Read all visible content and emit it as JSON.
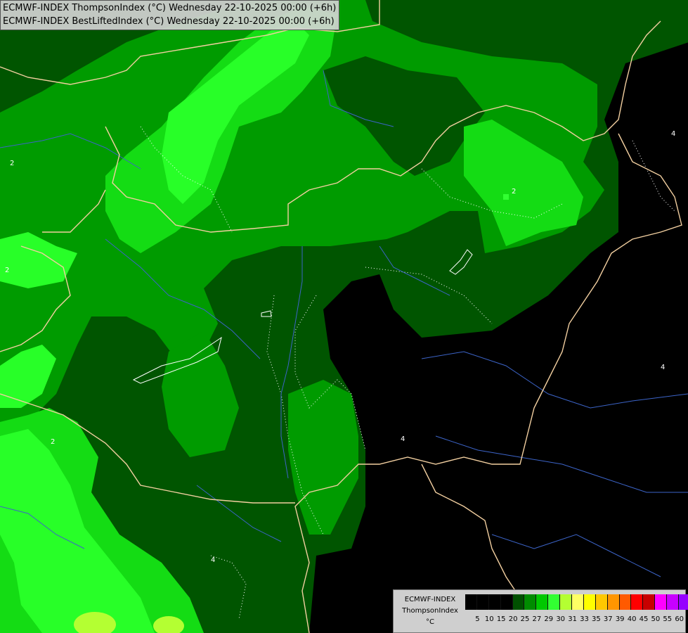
{
  "titles": {
    "line1": "ECMWF-INDEX ThompsonIndex (°C) Wednesday 22-10-2025 00:00 (+6h)",
    "line2": "ECMWF-INDEX BestLiftedIndex (°C) Wednesday 22-10-2025 00:00 (+6h)"
  },
  "legend": {
    "title": "ECMWF-INDEX",
    "subtitle": "ThompsonIndex",
    "unit": "°C",
    "ticks": [
      "5",
      "10",
      "15",
      "20",
      "25",
      "27",
      "29",
      "30",
      "31",
      "33",
      "35",
      "37",
      "39",
      "40",
      "45",
      "50",
      "55",
      "60"
    ],
    "colors": [
      "#000000",
      "#000000",
      "#000000",
      "#000000",
      "#005000",
      "#008c00",
      "#00c800",
      "#32ff32",
      "#b4ff32",
      "#ffff64",
      "#ffff00",
      "#ffc800",
      "#ff9600",
      "#ff5a00",
      "#ff0000",
      "#c80000",
      "#ff00ff",
      "#c800ff",
      "#9600ff",
      "#6400ff",
      "#0000ff"
    ]
  },
  "contour_labels": [
    "2",
    "2",
    "2",
    "2",
    "4",
    "4",
    "4",
    "4"
  ],
  "fill_colors": {
    "dark_green": "#005500",
    "mid_green": "#009b00",
    "bright_green": "#14dc14",
    "lime": "#28ff28",
    "yellow_green": "#b4ff32",
    "background": "#000000",
    "border": "#f2cfa0",
    "river": "#3c64c8"
  }
}
